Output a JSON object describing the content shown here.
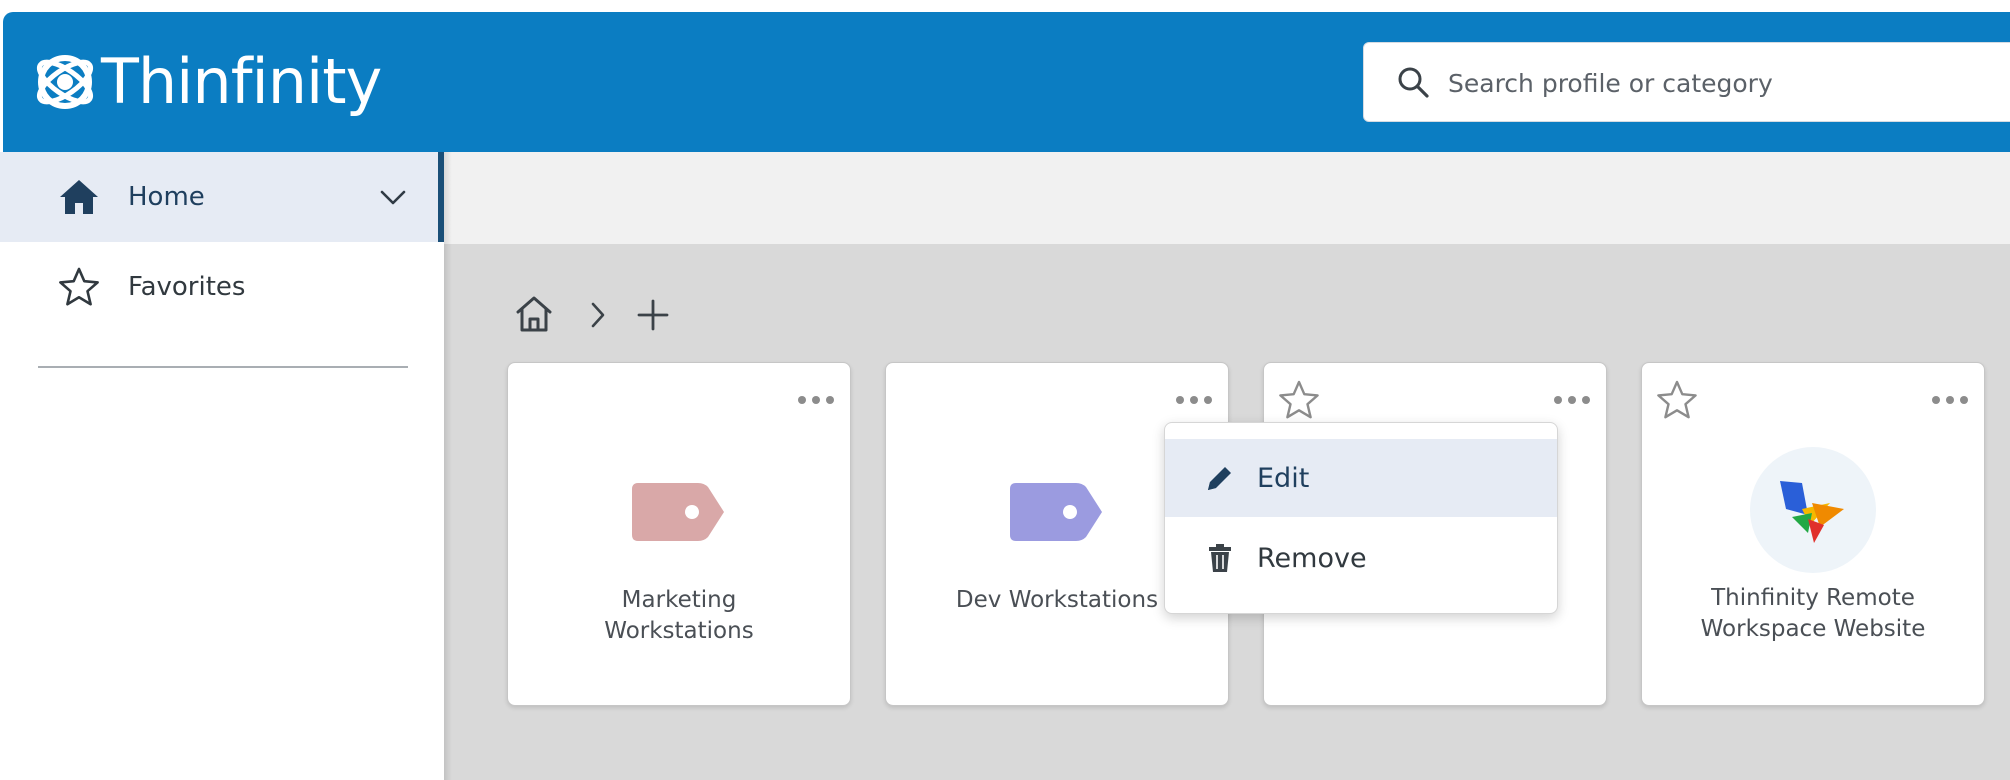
{
  "header": {
    "brand": "Thinfinity",
    "search_placeholder": "Search profile or category"
  },
  "sidebar": {
    "items": [
      {
        "label": "Home",
        "icon": "home-icon",
        "active": true
      },
      {
        "label": "Favorites",
        "icon": "star-icon",
        "active": false
      }
    ]
  },
  "breadcrumb": {
    "home_icon": "home-outline-icon",
    "separator_icon": "chevron-right-icon",
    "add_icon": "plus-icon"
  },
  "cards": [
    {
      "title_line1": "Marketing",
      "title_line2": "Workstations",
      "icon": "tag-icon",
      "icon_color": "#d9a8a8"
    },
    {
      "title_line1": "Dev Workstations",
      "title_line2": "",
      "icon": "tag-icon",
      "icon_color": "#9b9be0"
    },
    {
      "title_line1": "",
      "title_line2": "",
      "icon": "star-outline-icon"
    },
    {
      "title_line1": "Thinfinity Remote",
      "title_line2": "Workspace Website",
      "icon": "thinfinity-app-icon"
    }
  ],
  "context_menu": {
    "items": [
      {
        "label": "Edit",
        "icon": "pencil-icon",
        "highlighted": true
      },
      {
        "label": "Remove",
        "icon": "trash-icon",
        "highlighted": false
      }
    ]
  },
  "colors": {
    "header_bg": "#0b7dc2",
    "sidebar_active_bg": "#e6ebf4",
    "sidebar_accent": "#1a4f78",
    "main_bg": "#d9d9d9"
  }
}
